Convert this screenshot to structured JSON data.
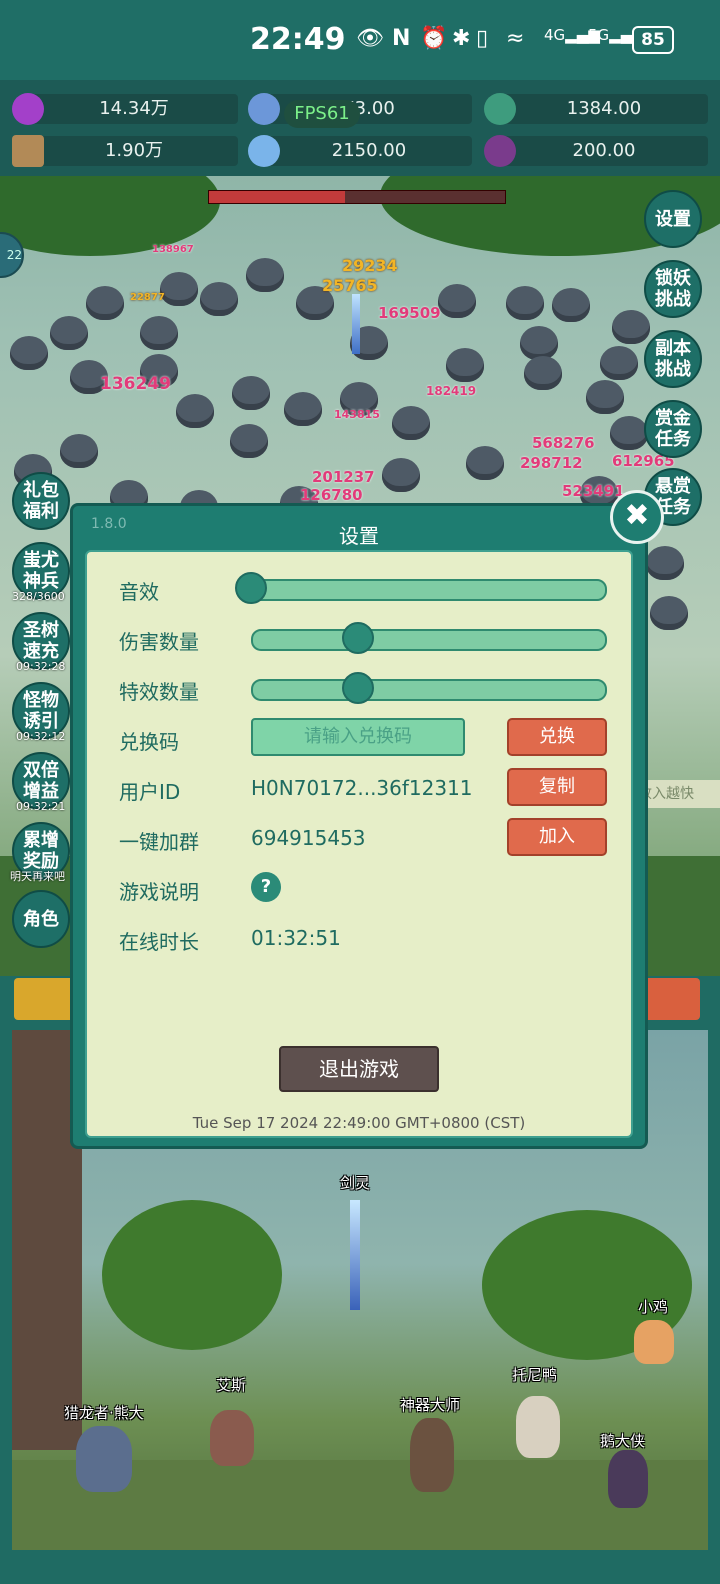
{
  "status_bar": {
    "time": "22:49",
    "icons": [
      "eye-icon",
      "nfc-icon",
      "alarm-icon",
      "bluetooth-icon",
      "vibrate-icon",
      "wifi-6-icon",
      "signal-4g-icon",
      "signal-5g-icon"
    ],
    "battery": "85"
  },
  "resources": {
    "row1": [
      {
        "icon": "purple-gem-icon",
        "value": "14.34万"
      },
      {
        "icon": "blue-crystal-icon",
        "value": "73.00"
      },
      {
        "icon": "green-orb-icon",
        "value": "1384.00"
      }
    ],
    "row2": [
      {
        "icon": "scroll-icon",
        "value": "1.90万"
      },
      {
        "icon": "ice-shard-icon",
        "value": "2150.00"
      },
      {
        "icon": "purple-pouch-icon",
        "value": "200.00"
      }
    ],
    "fps": "FPS61"
  },
  "battle": {
    "damage_numbers": [
      "29234",
      "25765",
      "169509",
      "136249",
      "568276",
      "298712",
      "201237",
      "126780",
      "523491",
      "138967",
      "22877",
      "143815",
      "182419",
      "612965"
    ],
    "tiny_level": "22"
  },
  "right_buttons": [
    "设置",
    "锁妖\n挑战",
    "副本\n挑战",
    "赏金\n任务",
    "悬赏\n任务"
  ],
  "left_buttons": [
    {
      "label": "礼包\n福利",
      "sub": ""
    },
    {
      "label": "蚩尤\n神兵",
      "sub": "328/3600"
    },
    {
      "label": "圣树\n速充",
      "sub": "09:32:28"
    },
    {
      "label": "怪物\n诱引",
      "sub": "09:32:12"
    },
    {
      "label": "双倍\n增益",
      "sub": "09:32:21"
    },
    {
      "label": "累增\n奖励",
      "sub": "明天再来吧"
    },
    {
      "label": "角色",
      "sub": ""
    }
  ],
  "scene": {
    "npcs": [
      "剑灵",
      "小鸡",
      "艾斯",
      "托尼鸭",
      "猎龙者·熊大",
      "神器大师",
      "鹅大侠"
    ],
    "banner_text": "尘收入越快"
  },
  "dialog": {
    "version": "1.8.0",
    "title": "设置",
    "sound_label": "音效",
    "sound_level": 0.0,
    "damage_count_label": "伤害数量",
    "damage_count_level": 0.3,
    "effects_label": "特效数量",
    "effects_level": 0.3,
    "redeem_label": "兑换码",
    "redeem_placeholder": "请输入兑换码",
    "redeem_button": "兑换",
    "user_id_label": "用户ID",
    "user_id_value": "H0N70172...36f12311",
    "copy_button": "复制",
    "group_label": "一键加群",
    "group_value": "694915453",
    "join_button": "加入",
    "guide_label": "游戏说明",
    "guide_button": "?",
    "online_label": "在线时长",
    "online_value": "01:32:51",
    "quit_button": "退出游戏",
    "timestamp": "Tue Sep 17 2024 22:49:00 GMT+0800 (CST)",
    "close_icon": "close-icon"
  },
  "colors": {
    "panel_bg": "#e6eec8",
    "dialog_frame": "#1e7d71",
    "red_button": "#e06a4c",
    "label_text": "#1f6b60"
  }
}
